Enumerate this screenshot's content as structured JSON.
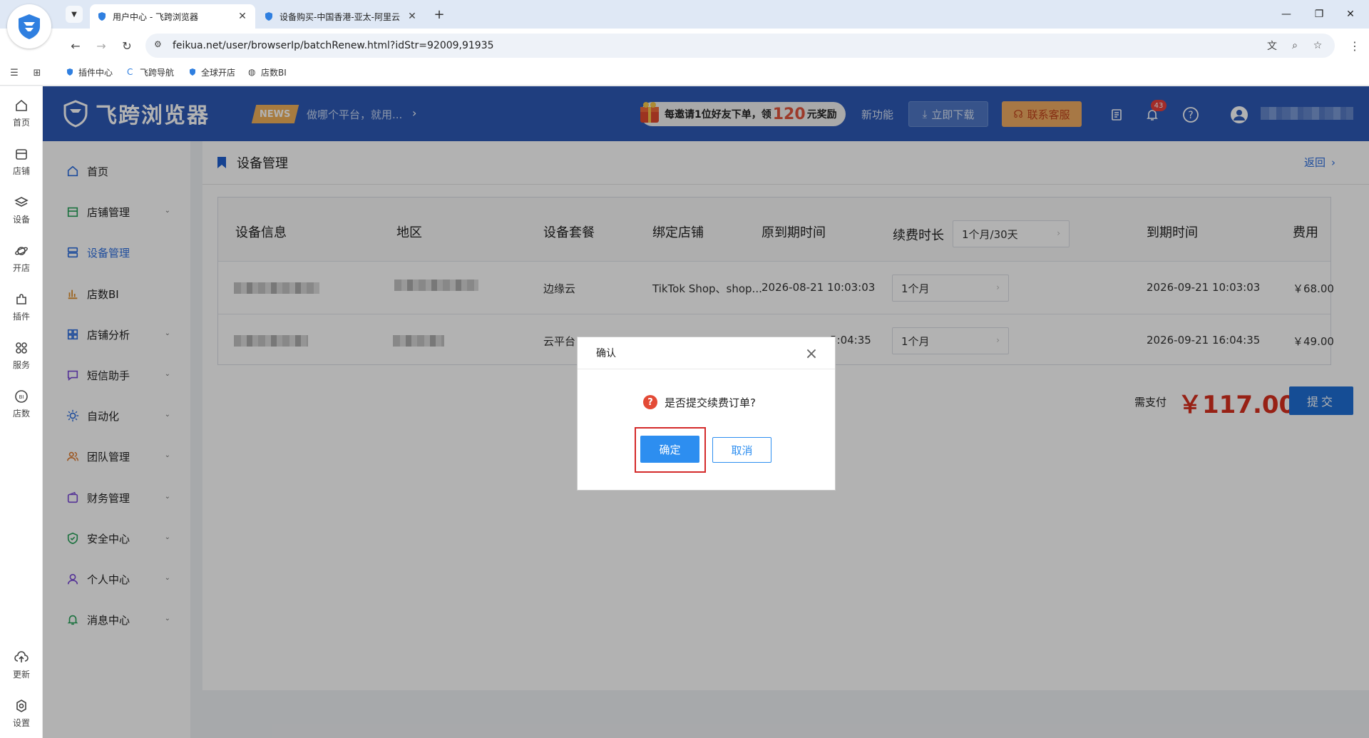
{
  "browser": {
    "tabs": [
      {
        "title": "用户中心 - 飞跨浏览器",
        "active": true
      },
      {
        "title": "设备购买-中国香港-亚太-阿里云",
        "active": false
      }
    ],
    "url": "feikua.net/user/browserIp/batchRenew.html?idStr=92009,91935",
    "bookmarks": [
      "插件中心",
      "飞跨导航",
      "全球开店",
      "店数BI"
    ]
  },
  "rail": {
    "items": [
      "首页",
      "店铺",
      "设备",
      "开店",
      "插件",
      "服务",
      "店数"
    ],
    "bottom": [
      "更新",
      "设置"
    ]
  },
  "header": {
    "brand": "飞跨浏览器",
    "news_badge": "NEWS",
    "news_text": "做哪个平台，就用...",
    "invite_pre": "每邀请1位好友下单，领",
    "invite_num": "120",
    "invite_post": "元奖励",
    "new_features": "新功能",
    "download": "立即下载",
    "contact": "联系客服",
    "notif_count": "43"
  },
  "sidebar": {
    "items": [
      {
        "label": "首页",
        "icon": "home-icon",
        "chevron": false
      },
      {
        "label": "店铺管理",
        "icon": "store-icon",
        "chevron": true
      },
      {
        "label": "设备管理",
        "icon": "server-icon",
        "chevron": false,
        "active": true
      },
      {
        "label": "店数BI",
        "icon": "bar-chart-icon",
        "chevron": false
      },
      {
        "label": "店铺分析",
        "icon": "grid-icon",
        "chevron": true
      },
      {
        "label": "短信助手",
        "icon": "message-icon",
        "chevron": true
      },
      {
        "label": "自动化",
        "icon": "sun-gear-icon",
        "chevron": true
      },
      {
        "label": "团队管理",
        "icon": "team-icon",
        "chevron": true
      },
      {
        "label": "财务管理",
        "icon": "wallet-icon",
        "chevron": true
      },
      {
        "label": "安全中心",
        "icon": "shield-icon",
        "chevron": true
      },
      {
        "label": "个人中心",
        "icon": "person-icon",
        "chevron": true
      },
      {
        "label": "消息中心",
        "icon": "bell-icon",
        "chevron": true
      }
    ]
  },
  "page": {
    "title": "设备管理",
    "back": "返回"
  },
  "table": {
    "headers": {
      "device_info": "设备信息",
      "region": "地区",
      "package": "设备套餐",
      "store": "绑定店铺",
      "orig_expiry": "原到期时间",
      "renew_duration": "续费时长",
      "renew_select": "1个月/30天",
      "new_expiry": "到期时间",
      "fee": "费用"
    },
    "rows": [
      {
        "package": "边缘云",
        "store": "TikTok Shop、shop...",
        "orig_expiry": "2026-08-21 10:03:03",
        "duration": "1个月",
        "new_expiry": "2026-09-21 10:03:03",
        "fee": "￥68.00"
      },
      {
        "package": "云平台",
        "store": "",
        "orig_expiry": "5:04:35",
        "duration": "1个月",
        "new_expiry": "2026-09-21 16:04:35",
        "fee": "￥49.00"
      }
    ]
  },
  "summary": {
    "pay_label": "需支付",
    "amount": "￥117.00",
    "submit": "提交"
  },
  "dialog": {
    "title": "确认",
    "message": "是否提交续费订单?",
    "ok": "确定",
    "cancel": "取消"
  }
}
